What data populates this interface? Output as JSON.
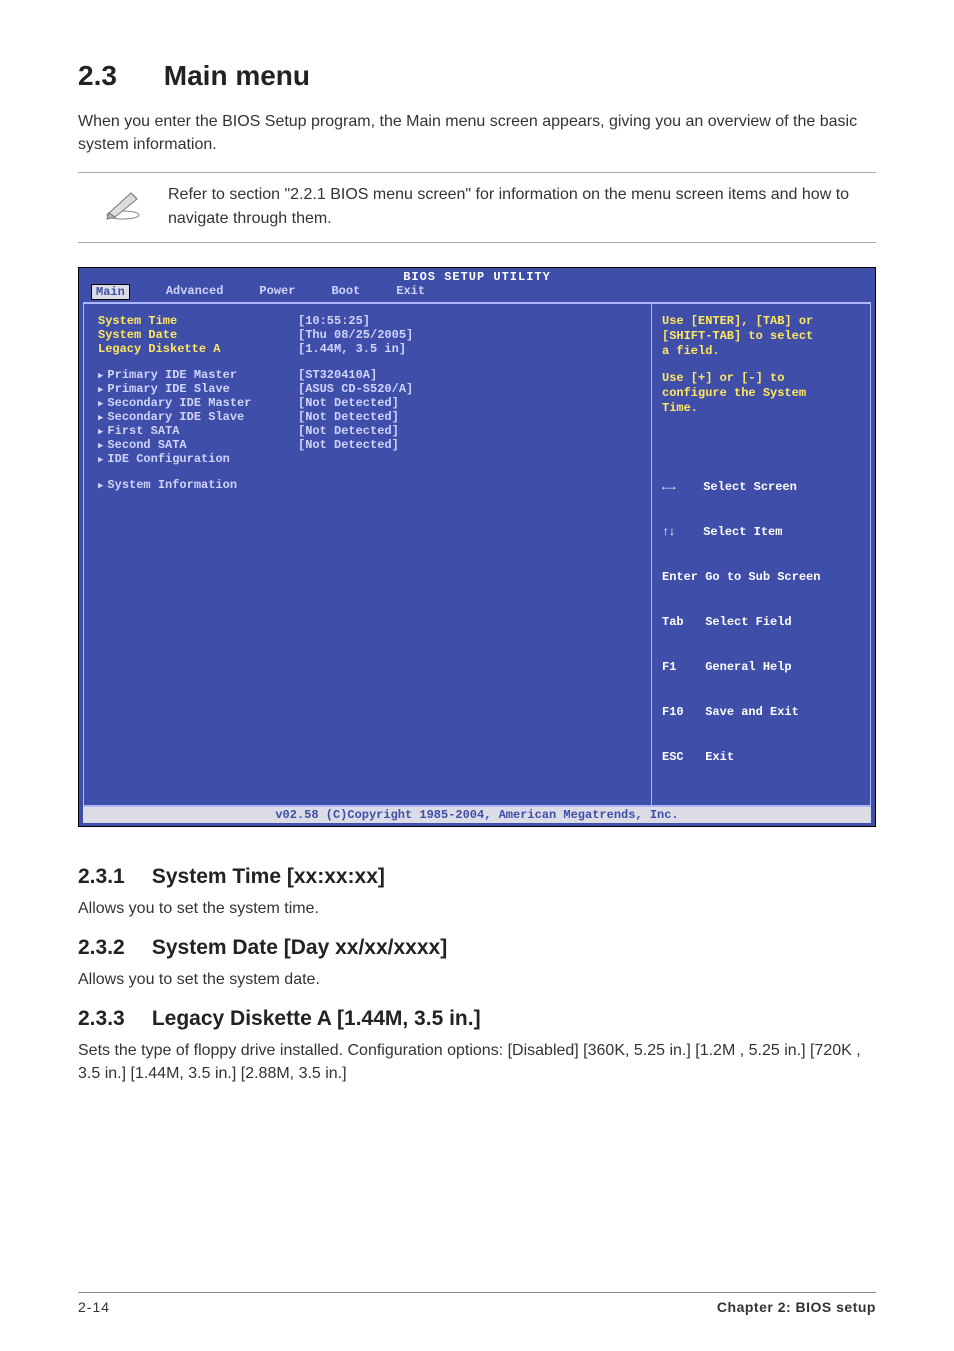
{
  "heading": {
    "number": "2.3",
    "title": "Main menu"
  },
  "intro": "When you enter the BIOS Setup program, the Main menu screen appears, giving you an overview of the basic system information.",
  "note": "Refer to section \"2.2.1  BIOS menu screen\" for information on the menu screen items and how to navigate through them.",
  "bios": {
    "title": "BIOS SETUP UTILITY",
    "tabs": [
      "Main",
      "Advanced",
      "Power",
      "Boot",
      "Exit"
    ],
    "activeTab": "Main",
    "fields": {
      "system_time_label": "System Time",
      "system_time_value": "[10:55:25]",
      "system_date_label": "System Date",
      "system_date_value": "[Thu 08/25/2005]",
      "legacy_label": "Legacy Diskette A",
      "legacy_value": "[1.44M, 3.5 in]",
      "pide_master_label": "Primary IDE Master",
      "pide_master_value": "[ST320410A]",
      "pide_slave_label": "Primary IDE Slave",
      "pide_slave_value": "[ASUS CD-S520/A]",
      "side_master_label": "Secondary IDE Master",
      "side_master_value": "[Not Detected]",
      "side_slave_label": "Secondary IDE Slave",
      "side_slave_value": "[Not Detected]",
      "first_sata_label": "First SATA",
      "first_sata_value": "[Not Detected]",
      "second_sata_label": "Second SATA",
      "second_sata_value": "[Not Detected]",
      "ide_conf_label": "IDE Configuration",
      "sys_info_label": "System Information"
    },
    "help1": "Use [ENTER], [TAB] or\n[SHIFT-TAB] to select\na field.",
    "help2": "Use [+] or [-] to\nconfigure the System\nTime.",
    "nav": {
      "l1a": "←→",
      "l1b": "Select Screen",
      "l2a": "↑↓",
      "l2b": "Select Item",
      "l3a": "Enter",
      "l3b": "Go to Sub Screen",
      "l4a": "Tab",
      "l4b": "Select Field",
      "l5a": "F1",
      "l5b": "General Help",
      "l6a": "F10",
      "l6b": "Save and Exit",
      "l7a": "ESC",
      "l7b": "Exit"
    },
    "footer": "v02.58 (C)Copyright 1985-2004, American Megatrends, Inc."
  },
  "sections": {
    "s1_num": "2.3.1",
    "s1_title": "System Time [xx:xx:xx]",
    "s1_body": "Allows you to set the system time.",
    "s2_num": "2.3.2",
    "s2_title": "System Date [Day xx/xx/xxxx]",
    "s2_body": "Allows you to set the system date.",
    "s3_num": "2.3.3",
    "s3_title": "Legacy Diskette A [1.44M, 3.5 in.]",
    "s3_body": "Sets the type of floppy drive installed. Configuration options: [Disabled] [360K, 5.25 in.] [1.2M , 5.25 in.] [720K , 3.5 in.] [1.44M, 3.5 in.] [2.88M, 3.5 in.]"
  },
  "footer": {
    "pagenum": "2-14",
    "chapter": "Chapter 2: BIOS setup"
  }
}
